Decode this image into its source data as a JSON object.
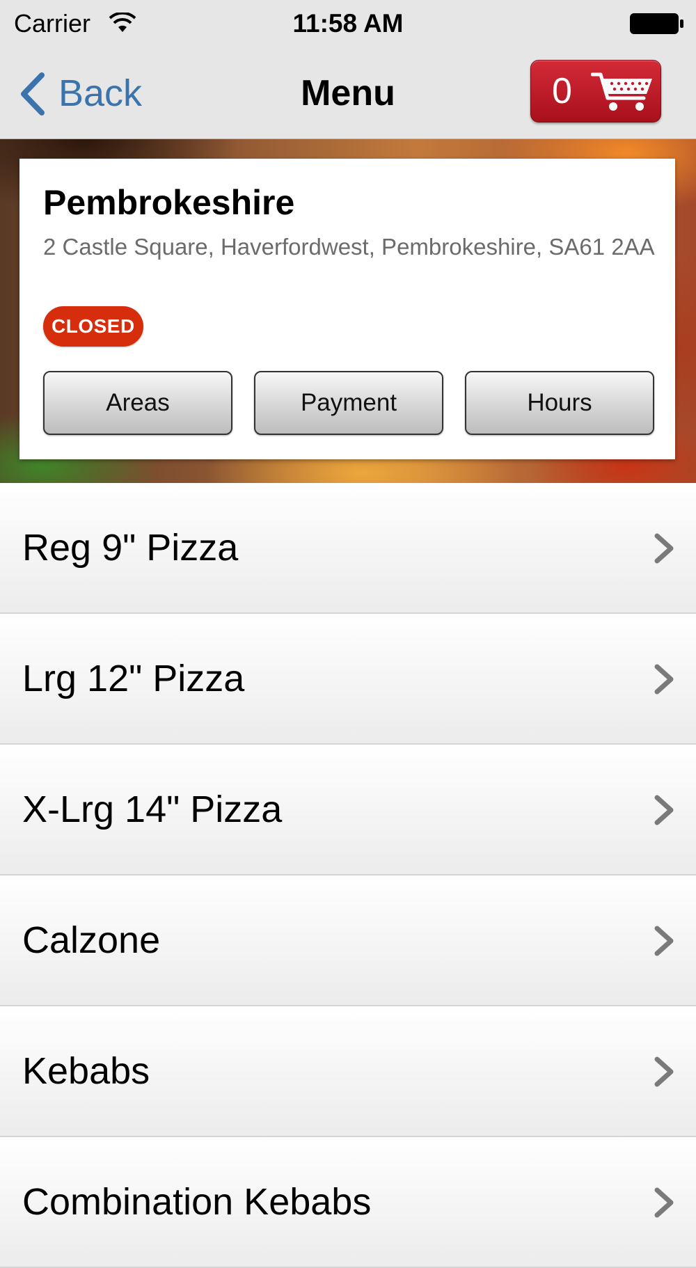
{
  "status_bar": {
    "carrier": "Carrier",
    "time": "11:58 AM",
    "icons": [
      "wifi-icon",
      "battery-icon"
    ]
  },
  "nav": {
    "back_label": "Back",
    "title": "Menu",
    "cart_count": "0",
    "cart_icon": "shopping-cart-icon",
    "colors": {
      "back": "#3b73ad",
      "cart": "#c0192a"
    }
  },
  "store": {
    "name": "Pembrokeshire",
    "address": "2 Castle Square, Haverfordwest, Pembrokeshire, SA61 2AA",
    "status": "CLOSED",
    "status_color": "#d62d0c",
    "buttons": [
      "Areas",
      "Payment",
      "Hours"
    ]
  },
  "menu": {
    "items": [
      {
        "label": "Reg 9\" Pizza"
      },
      {
        "label": "Lrg 12\" Pizza"
      },
      {
        "label": "X-Lrg 14\" Pizza"
      },
      {
        "label": "Calzone"
      },
      {
        "label": "Kebabs"
      },
      {
        "label": "Combination Kebabs"
      }
    ],
    "row_icon": "chevron-right-icon"
  }
}
